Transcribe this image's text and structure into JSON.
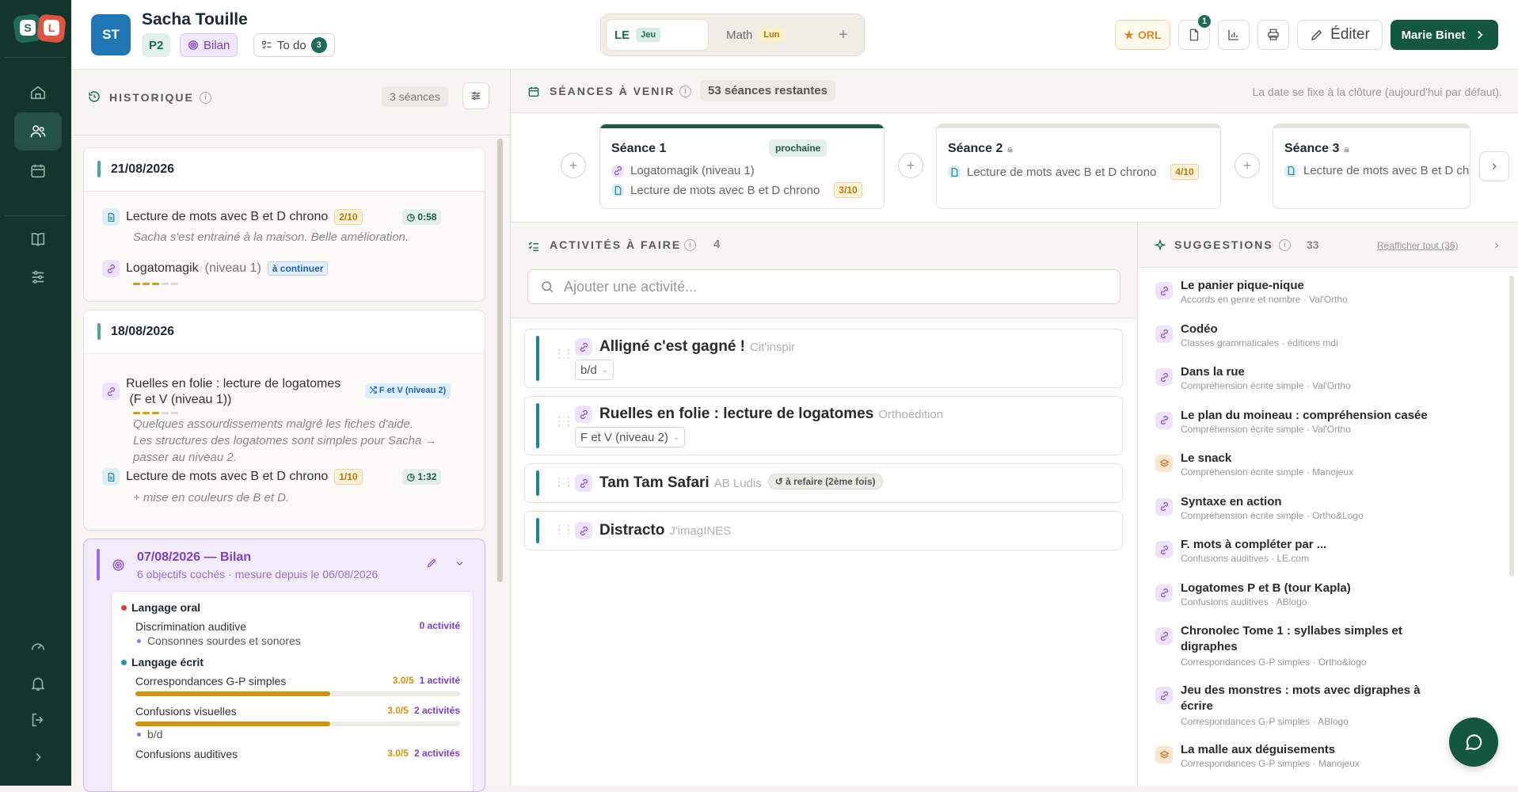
{
  "patient": {
    "initials": "ST",
    "name": "Sacha Touille",
    "level": "P2",
    "bilan_label": "Bilan",
    "todo_label": "To do",
    "todo_count": "3"
  },
  "tabs": [
    {
      "label": "LE",
      "badge": "Jeu",
      "active": true
    },
    {
      "label": "Math",
      "badge": "Lun",
      "active": false
    }
  ],
  "tab_add": "+",
  "toolbar": {
    "orl_label": "ORL",
    "docs_badge": "1",
    "edit_label": "Éditer",
    "user_label": "Marie Binet"
  },
  "history": {
    "title": "HISTORIQUE",
    "count": "3 séances",
    "sessions": [
      {
        "date": "21/08/2026",
        "activities": [
          {
            "name": "Lecture de mots avec B et D chrono",
            "score": "2/10",
            "time": "0:58",
            "note": "Sacha s'est entrainé à la maison. Belle amélioration."
          },
          {
            "name": "Logatomagik",
            "level": "(niveau 1)",
            "status": "à continuer",
            "progress": 0.6
          }
        ]
      },
      {
        "date": "18/08/2026",
        "activities": [
          {
            "name_line1": "Ruelles en folie : lecture de logatomes",
            "name_line2": "(F et V (niveau 1))",
            "tag": "F et V (niveau 2)",
            "progress": 0.6,
            "note_lines": [
              "Quelques assourdissements malgré les fiches d'aide.",
              "Les structures des logatomes sont simples pour Sacha →",
              "passer au niveau 2."
            ]
          },
          {
            "name": "Lecture de mots avec B et D chrono",
            "score": "1/10",
            "time": "1:32",
            "note": "+ mise en couleurs de B et D."
          }
        ]
      }
    ],
    "bilan": {
      "title": "07/08/2026 — Bilan",
      "subtitle": "6 objectifs cochés · mesure depuis le 06/08/2026",
      "objectives": [
        {
          "name": "Langage oral",
          "color": "#e23b3b"
        },
        {
          "name": "Langage écrit",
          "color": "#1b9aaa"
        }
      ],
      "items": [
        {
          "name": "Discrimination auditive",
          "score": "",
          "count": "0 activité",
          "detail": "Consonnes sourdes et sonores"
        },
        {
          "name": "Correspondances G-P simples",
          "score": "3.0/5",
          "count": "1 activité",
          "fill": 0.6
        },
        {
          "name": "Confusions visuelles",
          "score": "3.0/5",
          "count": "2 activités",
          "fill": 0.6,
          "detail": "b/d"
        },
        {
          "name": "Confusions auditives",
          "score": "3.0/5",
          "count": "2 activités"
        }
      ]
    }
  },
  "upcoming": {
    "title": "SÉANCES À VENIR",
    "remaining": "53 séances restantes",
    "hint": "La date se fixe à la clôture (aujourd'hui par défaut).",
    "sessions": [
      {
        "title": "Séance 1",
        "badge": "prochaine",
        "lines": [
          {
            "icon": "game",
            "text": "Logatomagik (niveau 1)"
          },
          {
            "icon": "doc",
            "text": "Lecture de mots avec B et D chrono",
            "score": "3/10"
          }
        ]
      },
      {
        "title": "Séance 2",
        "lines": [
          {
            "icon": "doc",
            "text": "Lecture de mots avec B et D chrono",
            "score": "4/10"
          }
        ]
      },
      {
        "title": "Séance 3",
        "lines": [
          {
            "icon": "doc",
            "text": "Lecture de mots avec B et D chrono"
          }
        ]
      }
    ]
  },
  "todo": {
    "title": "ACTIVITÉS À FAIRE",
    "count": "4",
    "search_placeholder": "Ajouter une activité...",
    "activities": [
      {
        "name": "Alligné c'est gagné !",
        "publisher": "Cit'inspir",
        "option": "b/d"
      },
      {
        "name": "Ruelles en folie : lecture de logatomes",
        "publisher": "Orthoédition",
        "option": "F et V (niveau 2)"
      },
      {
        "name": "Tam Tam Safari",
        "publisher": "AB Ludis",
        "status": "à refaire (2ème fois)"
      },
      {
        "name": "Distracto",
        "publisher": "J'imagINES"
      }
    ]
  },
  "suggestions": {
    "title": "SUGGESTIONS",
    "count": "33",
    "show_all": "Réafficher tout (36)",
    "items": [
      {
        "title": "Le panier pique-nique",
        "meta": "Accords en genre et nombre · Val'Ortho",
        "icon": "game"
      },
      {
        "title": "Codéo",
        "meta": "Classes grammaticales · éditions mdi",
        "icon": "game"
      },
      {
        "title": "Dans la rue",
        "meta": "Compréhension écrite simple · Val'Ortho",
        "icon": "game"
      },
      {
        "title": "Le plan du moineau : compréhension casée",
        "meta": "Compréhension écrite simple · Val'Ortho",
        "icon": "game"
      },
      {
        "title": "Le snack",
        "meta": "Compréhension écrite simple · Manojeux",
        "icon": "stack"
      },
      {
        "title": "Syntaxe en action",
        "meta": "Compréhension écrite simple · Ortho&Logo",
        "icon": "game"
      },
      {
        "title": "F. mots à compléter par ...",
        "meta": "Confusions auditives · LE.com",
        "icon": "game"
      },
      {
        "title": "Logatomes P et B (tour Kapla)",
        "meta": "Confusions auditives · ABlogo",
        "icon": "game"
      },
      {
        "title": "Chronolec Tome 1 : syllabes simples et digraphes",
        "meta": "Correspondances G-P simples · Ortho&logo",
        "icon": "game"
      },
      {
        "title": "Jeu des monstres : mots avec digraphes à écrire",
        "meta": "Correspondances G-P simples · ABlogo",
        "icon": "game"
      },
      {
        "title": "La malle aux déguisements",
        "meta": "Correspondances G-P simples · Manojeux",
        "icon": "stack"
      }
    ]
  }
}
